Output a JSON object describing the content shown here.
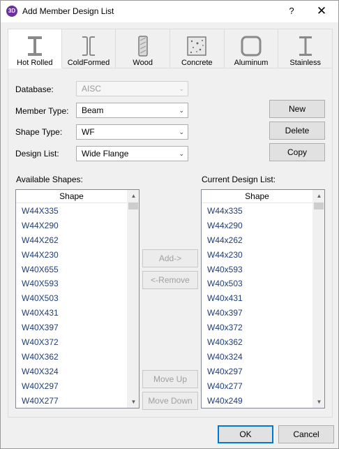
{
  "window": {
    "title": "Add Member Design List",
    "app_icon_text": "3D",
    "help_label": "?",
    "close_label": "✕"
  },
  "tabs": [
    {
      "label": "Hot Rolled",
      "icon": "i-beam-icon",
      "active": true
    },
    {
      "label": "ColdFormed",
      "icon": "cold-formed-icon",
      "active": false
    },
    {
      "label": "Wood",
      "icon": "wood-icon",
      "active": false
    },
    {
      "label": "Concrete",
      "icon": "concrete-icon",
      "active": false
    },
    {
      "label": "Aluminum",
      "icon": "aluminum-icon",
      "active": false
    },
    {
      "label": "Stainless",
      "icon": "stainless-icon",
      "active": false
    }
  ],
  "form": {
    "database_label": "Database:",
    "database_value": "AISC",
    "member_type_label": "Member Type:",
    "member_type_value": "Beam",
    "shape_type_label": "Shape Type:",
    "shape_type_value": "WF",
    "design_list_label": "Design List:",
    "design_list_value": "Wide Flange"
  },
  "buttons": {
    "new": "New",
    "delete": "Delete",
    "copy": "Copy",
    "add": "Add->",
    "remove": "<-Remove",
    "move_up": "Move Up",
    "move_down": "Move Down",
    "ok": "OK",
    "cancel": "Cancel"
  },
  "available": {
    "label": "Available Shapes:",
    "header": "Shape",
    "items": [
      "W44X335",
      "W44X290",
      "W44X262",
      "W44X230",
      "W40X655",
      "W40X593",
      "W40X503",
      "W40X431",
      "W40X397",
      "W40X372",
      "W40X362",
      "W40X324",
      "W40X297",
      "W40X277"
    ]
  },
  "current": {
    "label": "Current Design List:",
    "header": "Shape",
    "items": [
      "W44x335",
      "W44x290",
      "W44x262",
      "W44x230",
      "W40x593",
      "W40x503",
      "W40x431",
      "W40x397",
      "W40x372",
      "W40x362",
      "W40x324",
      "W40x297",
      "W40x277",
      "W40x249"
    ]
  },
  "scroll_arrows": {
    "up": "▲",
    "down": "▼"
  },
  "combo_arrow": "⌄",
  "colors": {
    "accent": "#0078d7",
    "list_text": "#1f3d7a",
    "app_icon": "#6b2fa0"
  }
}
